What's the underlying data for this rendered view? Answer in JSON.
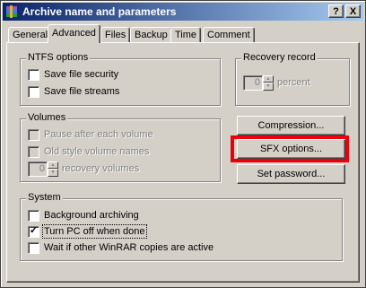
{
  "window": {
    "title": "Archive name and parameters",
    "help_label": "?",
    "close_label": "X"
  },
  "tabs": [
    {
      "label": "General",
      "active": false
    },
    {
      "label": "Advanced",
      "active": true
    },
    {
      "label": "Files",
      "active": false
    },
    {
      "label": "Backup",
      "active": false
    },
    {
      "label": "Time",
      "active": false
    },
    {
      "label": "Comment",
      "active": false
    }
  ],
  "ntfs": {
    "title": "NTFS options",
    "items": [
      {
        "label": "Save file security",
        "checked": false
      },
      {
        "label": "Save file streams",
        "checked": false
      }
    ]
  },
  "recovery": {
    "title": "Recovery record",
    "value": "0",
    "unit": "percent"
  },
  "volumes": {
    "title": "Volumes",
    "items": [
      {
        "label": "Pause after each volume",
        "checked": false
      },
      {
        "label": "Old style volume names",
        "checked": false
      }
    ],
    "recovery_value": "0",
    "recovery_label": "recovery volumes"
  },
  "buttons": {
    "compression": "Compression...",
    "sfx": "SFX options...",
    "password": "Set password..."
  },
  "system": {
    "title": "System",
    "items": [
      {
        "label": "Background archiving",
        "checked": false
      },
      {
        "label": "Turn PC off when done",
        "checked": true
      },
      {
        "label": "Wait if other WinRAR copies are active",
        "checked": false
      }
    ]
  },
  "check_mark": "✓",
  "colors": {
    "titlebar_start": "#0a246a",
    "titlebar_end": "#a6caf0",
    "dialog_face": "#d4d0c8",
    "highlight_box": "#e8000b"
  }
}
